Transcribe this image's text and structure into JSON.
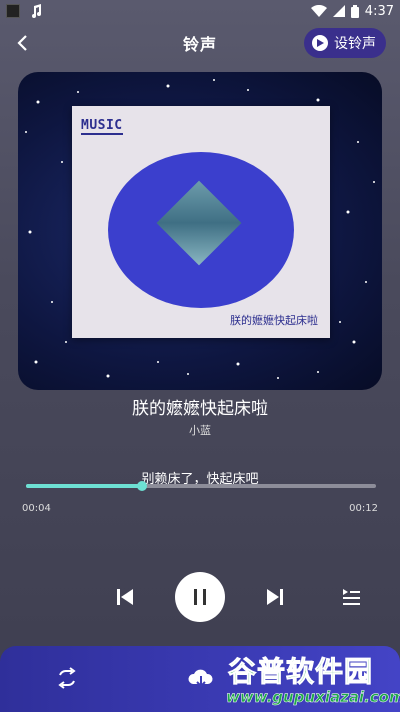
{
  "status_bar": {
    "time": "4:37"
  },
  "header": {
    "title": "铃声",
    "set_ringtone_label": "设铃声"
  },
  "album": {
    "card_label": "MUSIC",
    "card_title": "朕的嬷嬷快起床啦"
  },
  "song": {
    "title": "朕的嬷嬷快起床啦",
    "artist": "小蓝",
    "lyric": "别赖床了，快起床吧"
  },
  "playback": {
    "current_time": "00:04",
    "total_time": "00:12",
    "progress": 0.33,
    "state": "playing"
  },
  "watermark": {
    "text": "谷普软件园",
    "url": "www.gupuxiazai.com"
  },
  "colors": {
    "accent": "#6de0d3",
    "button_bg": "#3a2f8c",
    "bottom_bar": "#3b3bb5",
    "disc": "#3b3fcd"
  },
  "icons": {
    "back": "chevron-left-icon",
    "play_circle": "play-circle-icon",
    "prev": "skip-previous-icon",
    "pause": "pause-icon",
    "next": "skip-next-icon",
    "playlist": "playlist-icon",
    "loop": "repeat-icon",
    "cloud": "cloud-download-icon"
  }
}
